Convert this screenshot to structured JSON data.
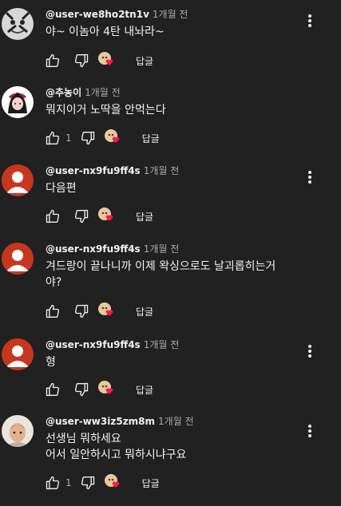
{
  "reply_label": "답글",
  "colors": {
    "background": "#212121",
    "text": "#f1f1f1",
    "meta": "#aaaaaa",
    "heart": "#ff1744",
    "avatar_default": "#c6371f"
  },
  "icons": {
    "like": "thumb-up-icon",
    "dislike": "thumb-down-icon",
    "heart": "creator-heart-icon",
    "menu": "more-vert-icon"
  },
  "comments": [
    {
      "author": "@user-we8ho2tn1v",
      "time": "1개월 전",
      "text": "야~ 이놈아 4탄 내놔라~",
      "likes": ""
    },
    {
      "author": "@추농이",
      "time": "1개월 전",
      "text": "뭐지이거 노딱을 안먹는다",
      "likes": "1"
    },
    {
      "author": "@user-nx9fu9ff4s",
      "time": "1개월 전",
      "text": "다음편",
      "likes": ""
    },
    {
      "author": "@user-nx9fu9ff4s",
      "time": "1개월 전",
      "text": "겨드랑이 끝나니까 이제 왁싱으로도 날괴롭히는거\n야?",
      "likes": ""
    },
    {
      "author": "@user-nx9fu9ff4s",
      "time": "1개월 전",
      "text": "형",
      "likes": ""
    },
    {
      "author": "@user-ww3iz5zm8m",
      "time": "1개월 전",
      "text": "선생님 뭐하세요\n어서 일안하시고 뭐하시냐구요",
      "likes": "1"
    }
  ]
}
